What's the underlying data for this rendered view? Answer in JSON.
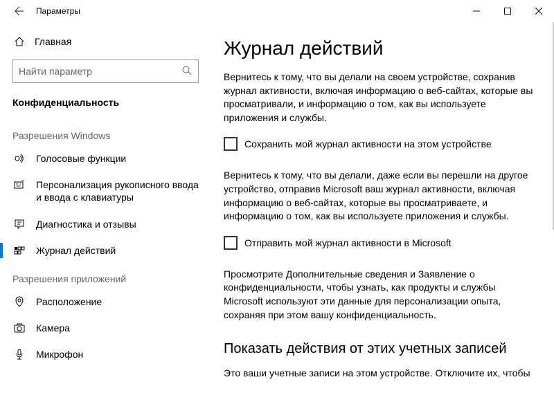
{
  "window": {
    "title": "Параметры"
  },
  "sidebar": {
    "home_label": "Главная",
    "search_placeholder": "Найти параметр",
    "current_section": "Конфиденциальность",
    "group_windows": "Разрешения Windows",
    "group_apps": "Разрешения приложений",
    "items": {
      "voice": "Голосовые функции",
      "inking": "Персонализация рукописного ввода и ввода с клавиатуры",
      "diag": "Диагностика и отзывы",
      "activity": "Журнал действий",
      "location": "Расположение",
      "camera": "Камера",
      "mic": "Микрофон"
    }
  },
  "main": {
    "heading": "Журнал действий",
    "desc1": "Вернитесь к тому, что вы делали на своем устройстве, сохранив журнал активности, включая информацию о веб-сайтах, которые вы просматривали, и информацию о том, как вы используете приложения и службы.",
    "cb1_label": "Сохранить мой журнал активности на этом устройстве",
    "desc2": "Вернитесь к тому, что вы делали, даже если вы перешли на другое устройство, отправив Microsoft ваш журнал активности, включая информацию о веб-сайтах, которые вы просматриваете, и информацию о том, как вы используете приложения и службы.",
    "cb2_label": "Отправить мой журнал активности в Microsoft",
    "desc3": "Просмотрите Дополнительные сведения и Заявление о конфиденциальности, чтобы узнать, как продукты и службы Microsoft используют эти данные для персонализации опыта, сохраняя при этом вашу конфиденциальность.",
    "heading2": "Показать действия от этих учетных записей",
    "desc4": "Это ваши учетные записи на этом устройстве. Отключите их, чтобы"
  }
}
